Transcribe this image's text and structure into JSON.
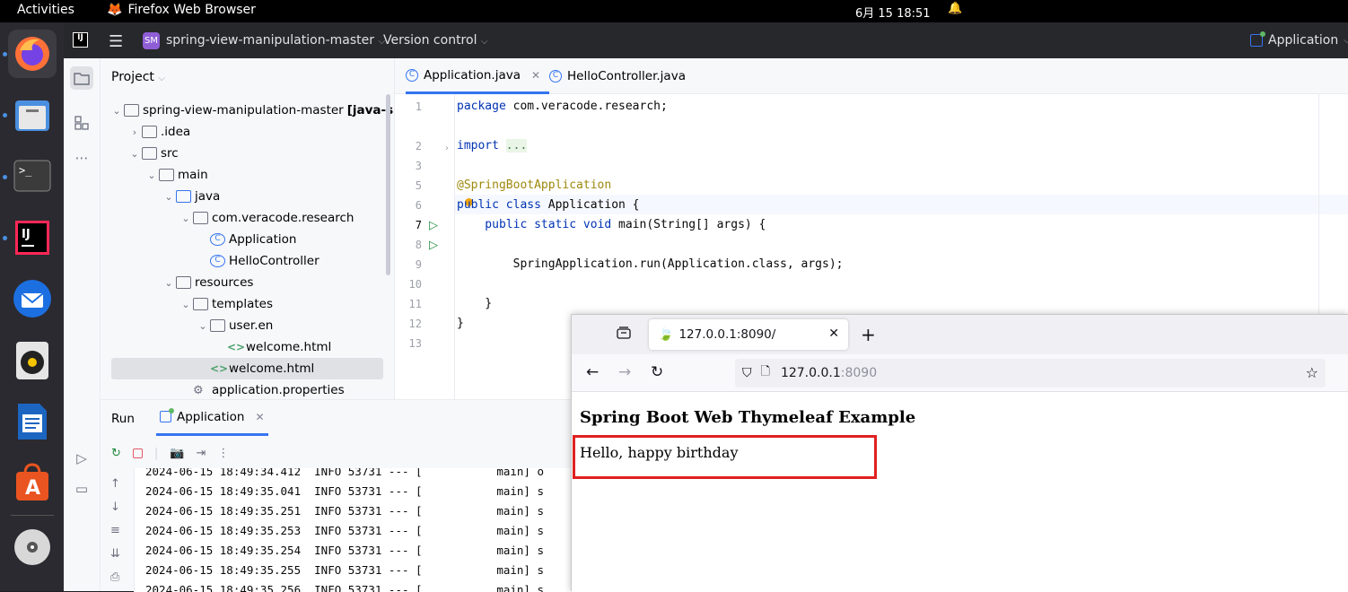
{
  "topbar": {
    "activities": "Activities",
    "app_name": "Firefox Web Browser",
    "clock": "6月 15  18:51"
  },
  "dock": {
    "items": [
      "firefox-icon",
      "files-icon",
      "terminal-icon",
      "intellij-icon",
      "thunderbird-icon",
      "rhythmbox-icon",
      "writer-icon",
      "app-center-icon",
      "disc-icon"
    ]
  },
  "ide": {
    "header": {
      "project_badge": "SM",
      "project_name": "spring-view-manipulation-master",
      "vcs": "Version control",
      "run_config": "Application"
    },
    "project_panel": {
      "title": "Project",
      "tree": [
        {
          "label": "spring-view-manipulation-master",
          "suffix": "[java-sprin"
        },
        {
          "label": ".idea"
        },
        {
          "label": "src"
        },
        {
          "label": "main"
        },
        {
          "label": "java"
        },
        {
          "label": "com.veracode.research"
        },
        {
          "label": "Application"
        },
        {
          "label": "HelloController"
        },
        {
          "label": "resources"
        },
        {
          "label": "templates"
        },
        {
          "label": "user.en"
        },
        {
          "label": "welcome.html"
        },
        {
          "label": "welcome.html"
        },
        {
          "label": "application.properties"
        }
      ]
    },
    "editor": {
      "tabs": [
        {
          "label": "Application.java",
          "active": true
        },
        {
          "label": "HelloController.java",
          "active": false
        }
      ],
      "line_numbers": [
        "1",
        "2",
        "3",
        "5",
        "6",
        "7",
        "8",
        "9",
        "10",
        "11",
        "12",
        "13"
      ],
      "code": {
        "l1_kw": "package",
        "l1_rest": " com.veracode.research;",
        "l3_kw": "import",
        "l3_dots": "...",
        "l6": "@SpringBootApplication",
        "l7_kw": "public class",
        "l7_rest": " Application {",
        "l8_kw": "    public static void",
        "l8_rest": " main(String[] args) {",
        "l10": "        SpringApplication.run(Application.class, args);",
        "l12": "    }",
        "l13": "}"
      }
    },
    "run_panel": {
      "title": "Run",
      "tab": "Application",
      "logs": [
        "2024-06-15 18:49:34.412  INFO 53731 --- [           main] o",
        "2024-06-15 18:49:35.041  INFO 53731 --- [           main] s",
        "2024-06-15 18:49:35.251  INFO 53731 --- [           main] s",
        "2024-06-15 18:49:35.253  INFO 53731 --- [           main] s",
        "2024-06-15 18:49:35.254  INFO 53731 --- [           main] s",
        "2024-06-15 18:49:35.255  INFO 53731 --- [           main] s",
        "2024-06-15 18:49:35.256  INFO 53731 --- [           main] s"
      ]
    }
  },
  "browser": {
    "tab_title": "127.0.0.1:8090/",
    "url_host": "127.0.0.1",
    "url_port": ":8090",
    "heading": "Spring Boot Web Thymeleaf Example",
    "message": "Hello, happy birthday"
  }
}
